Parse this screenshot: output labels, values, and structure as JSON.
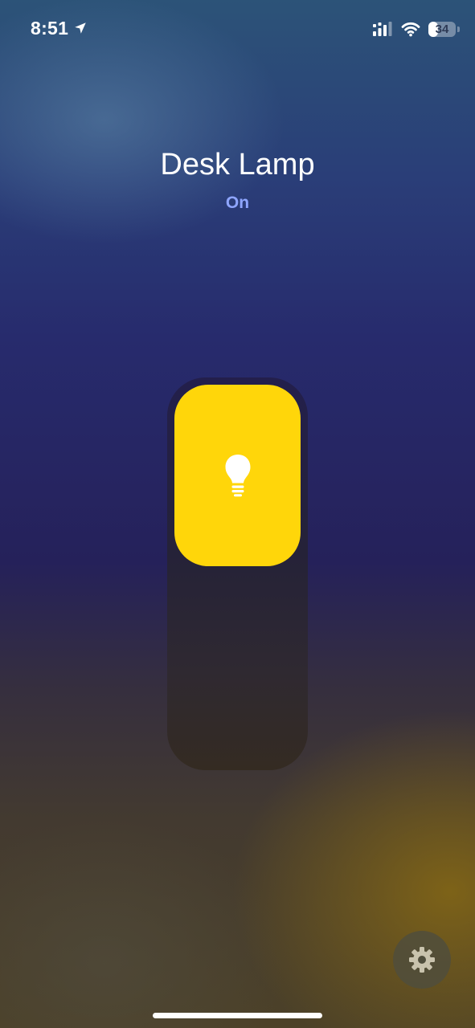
{
  "status_bar": {
    "time": "8:51",
    "battery_level": "34",
    "battery_fraction": 0.34,
    "icons": [
      "location-arrow-icon",
      "cellular-signal-icon",
      "wifi-icon",
      "battery-icon"
    ]
  },
  "device": {
    "name": "Desk Lamp",
    "state": "On",
    "state_color": "#8fa6ff"
  },
  "brightness": {
    "level_fraction": 0.48,
    "fill_color": "#ffd60a",
    "icon": "lightbulb-icon"
  },
  "controls": {
    "settings_icon": "gear-icon"
  }
}
